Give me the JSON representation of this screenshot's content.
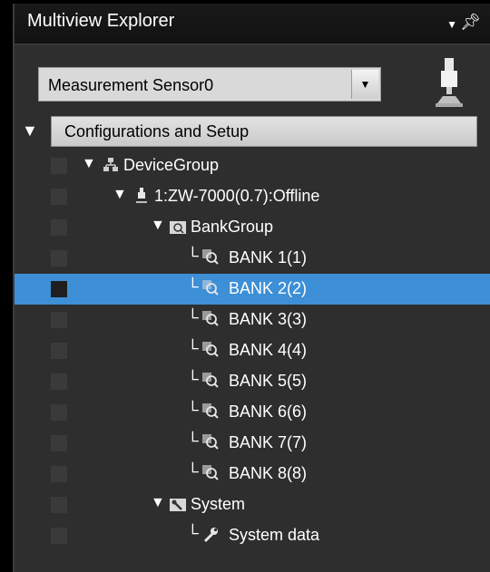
{
  "panel": {
    "title": "Multiview Explorer"
  },
  "selector": {
    "value": "Measurement Sensor0"
  },
  "tree": {
    "root_label": "Configurations and Setup",
    "items": [
      {
        "label": "DeviceGroup",
        "icon": "network-icon"
      },
      {
        "label": "1:ZW-7000(0.7):Offline",
        "icon": "sensor-icon"
      },
      {
        "label": "BankGroup",
        "icon": "folder-search-icon"
      },
      {
        "label": "BANK 1(1)",
        "icon": "magnifier-icon"
      },
      {
        "label": "BANK 2(2)",
        "icon": "magnifier-icon",
        "selected": true
      },
      {
        "label": "BANK 3(3)",
        "icon": "magnifier-icon"
      },
      {
        "label": "BANK 4(4)",
        "icon": "magnifier-icon"
      },
      {
        "label": "BANK 5(5)",
        "icon": "magnifier-icon"
      },
      {
        "label": "BANK 6(6)",
        "icon": "magnifier-icon"
      },
      {
        "label": "BANK 7(7)",
        "icon": "magnifier-icon"
      },
      {
        "label": "BANK 8(8)",
        "icon": "magnifier-icon"
      },
      {
        "label": "System",
        "icon": "folder-wrench-icon"
      },
      {
        "label": "System data",
        "icon": "wrench-icon"
      }
    ]
  },
  "colors": {
    "selection": "#3d8fd6",
    "panel_bg": "#2e2e2e"
  }
}
